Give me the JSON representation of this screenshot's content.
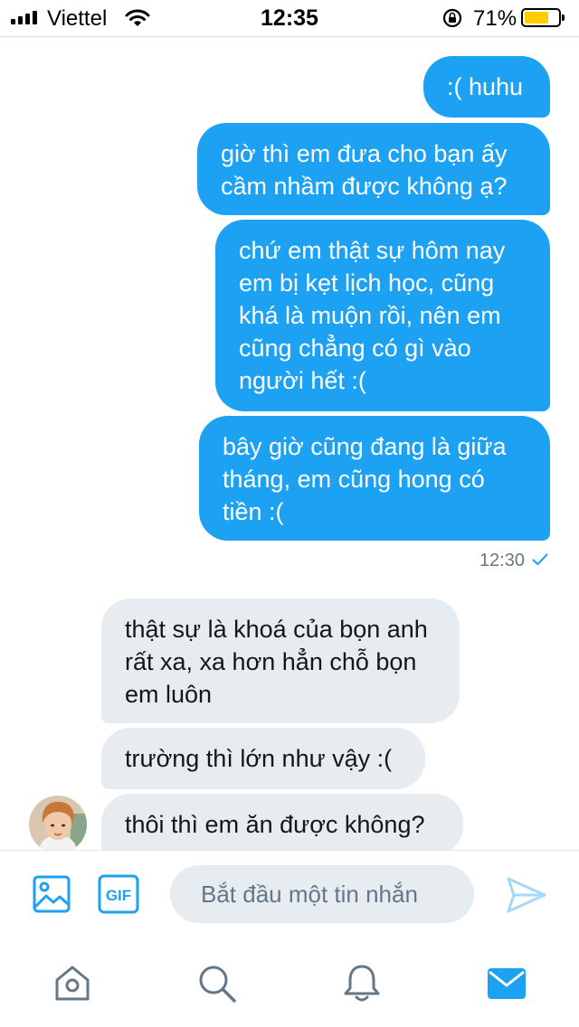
{
  "status_bar": {
    "carrier": "Viettel",
    "time": "12:35",
    "battery_percent": "71%",
    "battery_level": 0.71,
    "battery_color": "#ffcc00"
  },
  "colors": {
    "sent_bubble": "#1da1f2",
    "received_bubble": "#e6ecf0",
    "accent": "#1da1f2"
  },
  "conversation": {
    "sent": [
      ":( huhu",
      "giờ thì em đưa cho bạn ấy cầm nhầm được không ạ?",
      "chứ em thật sự hôm nay em bị kẹt lịch học, cũng khá là muộn rồi, nên em cũng chẳng có gì vào người hết :(",
      "bây giờ cũng đang là giữa tháng, em cũng hong có tiền :("
    ],
    "sent_time": "12:30",
    "received": [
      "thật sự là khoá của bọn anh rất xa, xa hơn hẳn chỗ bọn em luôn",
      "trường thì lớn như vậy :(",
      "thôi thì em ăn được không?"
    ]
  },
  "composer": {
    "image_icon": "image-icon",
    "gif_label": "GIF",
    "placeholder": "Bắt đầu một tin nhắn",
    "send_icon": "send-icon"
  },
  "tab_bar": {
    "items": [
      "home-icon",
      "search-icon",
      "notifications-icon",
      "messages-icon"
    ],
    "active": "messages-icon"
  }
}
